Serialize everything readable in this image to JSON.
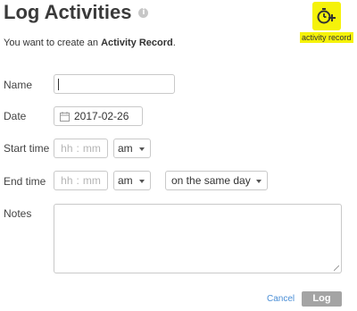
{
  "header": {
    "title": "Log Activities",
    "info_icon": "info-icon",
    "activity_button_icon": "activity-add-icon",
    "activity_caption": "activity record"
  },
  "subtitle": {
    "prefix": "You want to create an ",
    "bold": "Activity Record",
    "suffix": "."
  },
  "form": {
    "name_label": "Name",
    "name_value": "",
    "date_label": "Date",
    "date_value": "2017-02-26",
    "start_time_label": "Start time",
    "start_hh_placeholder": "hh",
    "start_mm_placeholder": "mm",
    "start_ampm": "am",
    "end_time_label": "End time",
    "end_hh_placeholder": "hh",
    "end_mm_placeholder": "mm",
    "end_ampm": "am",
    "end_day": "on the same day",
    "notes_label": "Notes",
    "notes_value": ""
  },
  "actions": {
    "cancel_label": "Cancel",
    "log_label": "Log"
  },
  "colors": {
    "highlight": "#f5f20a",
    "link": "#4a8ed6",
    "log_button": "#a4a4a4"
  }
}
